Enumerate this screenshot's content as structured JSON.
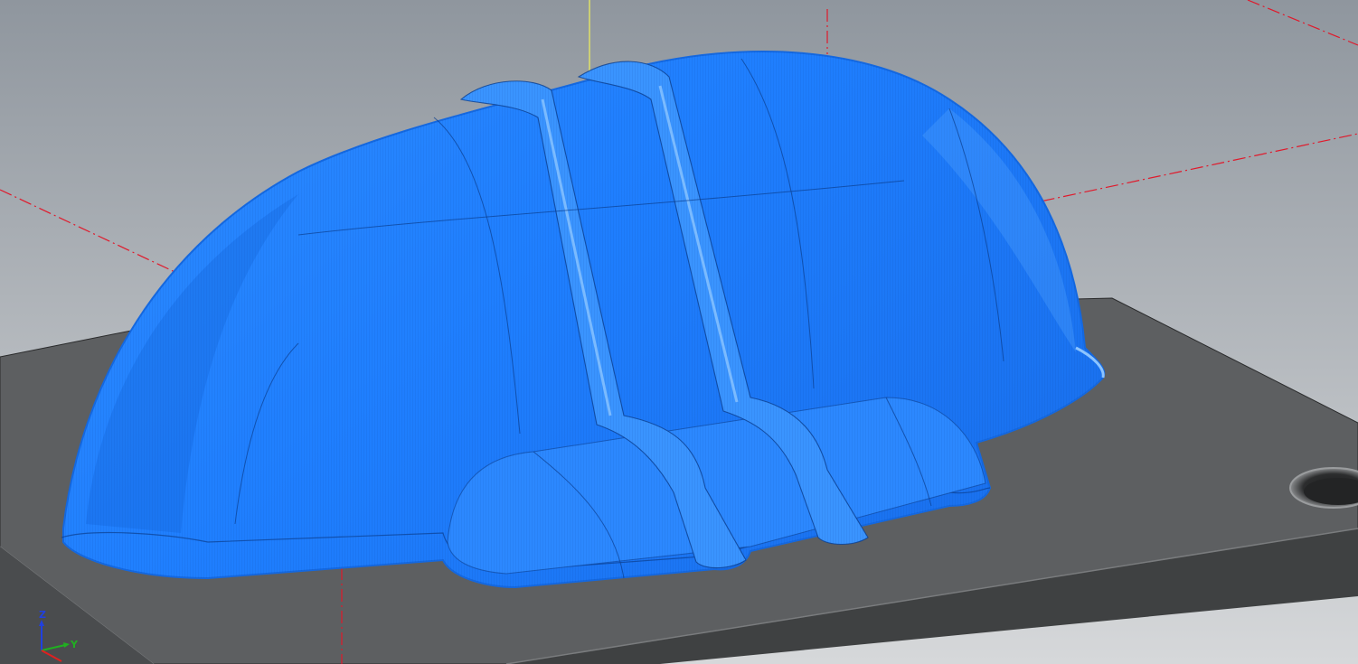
{
  "viewport": {
    "name": "cad-3d-viewport",
    "background_top": "#8f969e",
    "background_bottom": "#d6d8da"
  },
  "colors": {
    "part_surface": "#1f7fff",
    "part_highlight": "#5aa8ff",
    "part_shadow": "#0a56c8",
    "toolpath_line": "#0b3f8f",
    "stock_top": "#5d5f61",
    "stock_side": "#3f4142",
    "stock_edge": "#2a2b2c",
    "construction_line": "#e0192b",
    "vertical_axis_line": "#f2f25a"
  },
  "view_triad": {
    "icon": "xyz-axis-triad-icon",
    "z_label": "Z",
    "y_label": "Y",
    "x_color": "#e02020",
    "y_color": "#20b020",
    "z_color": "#2040e0"
  },
  "features": {
    "part": "blue-finished-part-with-toolpaths",
    "stock": "dark-grey-stock-plate",
    "hole": "through-hole-in-stock"
  }
}
